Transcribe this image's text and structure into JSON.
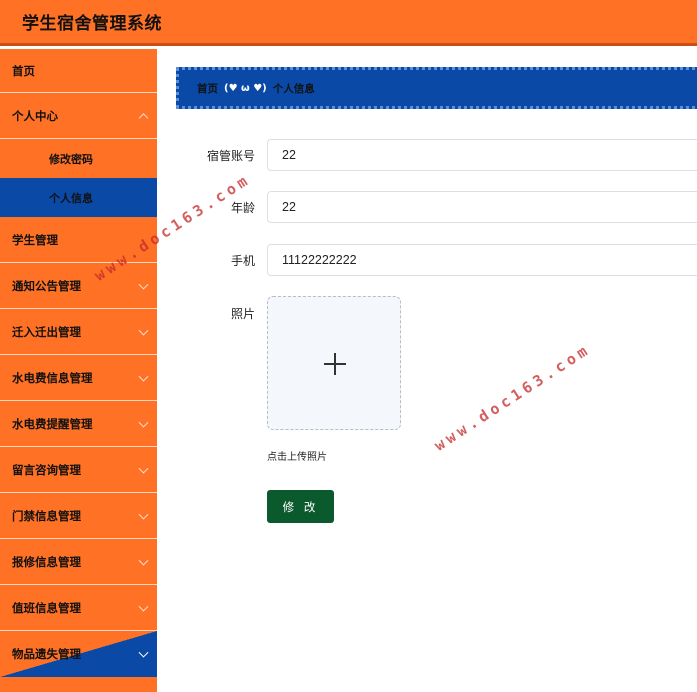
{
  "app": {
    "title": "学生宿舍管理系统"
  },
  "sidebar": {
    "items": [
      {
        "label": "首页"
      },
      {
        "label": "个人中心",
        "children": [
          {
            "label": "修改密码"
          },
          {
            "label": "个人信息",
            "active": true
          }
        ]
      },
      {
        "label": "学生管理"
      },
      {
        "label": "通知公告管理"
      },
      {
        "label": "迁入迁出管理"
      },
      {
        "label": "水电费信息管理"
      },
      {
        "label": "水电费提醒管理"
      },
      {
        "label": "留言咨询管理"
      },
      {
        "label": "门禁信息管理"
      },
      {
        "label": "报修信息管理"
      },
      {
        "label": "值班信息管理"
      },
      {
        "label": "物品遗失管理"
      }
    ]
  },
  "breadcrumb": {
    "home": "首页",
    "emote": "(♥ ω ♥)",
    "current": "个人信息"
  },
  "form": {
    "account": {
      "label": "宿管账号",
      "value": "22"
    },
    "age": {
      "label": "年龄",
      "value": "22"
    },
    "phone": {
      "label": "手机",
      "value": "11122222222"
    },
    "photo": {
      "label": "照片",
      "tip": "点击上传照片"
    },
    "submit_label": "修 改"
  },
  "watermark": "www.doc163.com",
  "colors": {
    "header": "#ff7125",
    "sidebar": "#ff7125",
    "accent_blue": "#0a4aa6",
    "submit": "#0b5a2e"
  }
}
